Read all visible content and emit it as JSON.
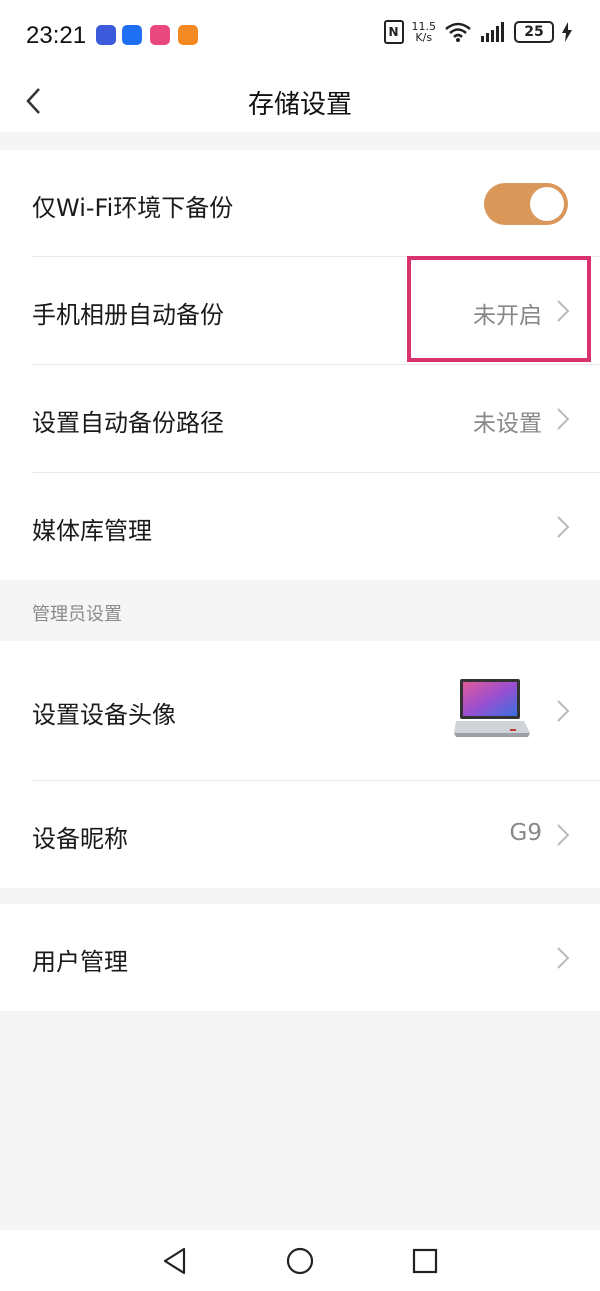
{
  "status_bar": {
    "time": "23:21",
    "speed_value": "11.5",
    "speed_unit": "K/s",
    "battery": "25",
    "icons": [
      "app-tie-icon",
      "app-zhijia-icon",
      "app-lala-icon",
      "app-orange-icon",
      "nfc-icon",
      "wifi-icon",
      "signal-icon",
      "battery-icon",
      "charging-icon"
    ]
  },
  "header": {
    "title": "存储设置",
    "back_icon": "chevron-left-icon"
  },
  "group1": {
    "wifi_only": {
      "label": "仅Wi-Fi环境下备份",
      "enabled": true,
      "toggle_color": "#d9975a"
    },
    "auto_backup": {
      "label": "手机相册自动备份",
      "value": "未开启"
    },
    "backup_path": {
      "label": "设置自动备份路径",
      "value": "未设置"
    },
    "media_library": {
      "label": "媒体库管理"
    }
  },
  "admin_section": {
    "heading": "管理员设置",
    "avatar": {
      "label": "设置设备头像"
    },
    "nickname": {
      "label": "设备昵称",
      "value": "G9"
    }
  },
  "group3": {
    "user_mgmt": {
      "label": "用户管理"
    }
  },
  "colors": {
    "highlight": "#d8326f",
    "accent": "#d9975a"
  },
  "nav": {
    "icons": [
      "nav-back-icon",
      "nav-home-icon",
      "nav-recents-icon"
    ]
  }
}
